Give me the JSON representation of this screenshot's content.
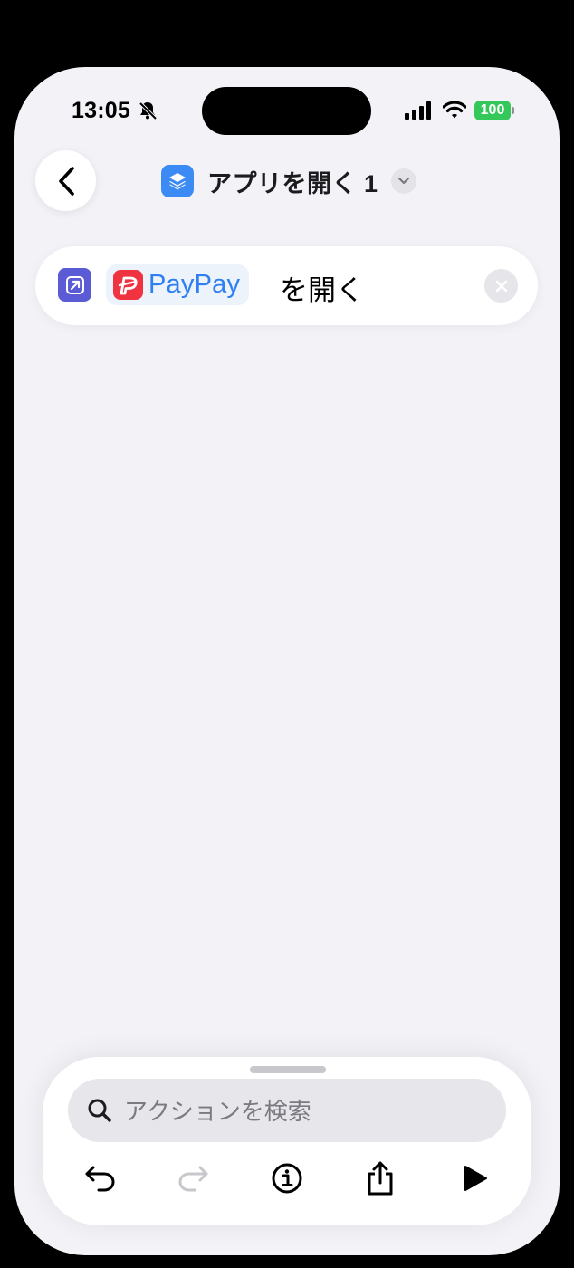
{
  "status_bar": {
    "time": "13:05",
    "battery": "100"
  },
  "header": {
    "title": "アプリを開く 1"
  },
  "action": {
    "app_name": "PayPay",
    "verb": "を開く"
  },
  "search": {
    "placeholder": "アクションを検索"
  },
  "toolbar": {
    "icons": [
      "undo-icon",
      "redo-icon",
      "info-icon",
      "share-icon",
      "play-icon"
    ],
    "redo_enabled": false
  },
  "colors": {
    "background": "#f2f2f7",
    "shortcut_icon": "#3c8bf5",
    "action_icon": "#5b5bd6",
    "app_link": "#2f7ff0",
    "paypay_red": "#ef3340",
    "battery": "#34c759"
  }
}
